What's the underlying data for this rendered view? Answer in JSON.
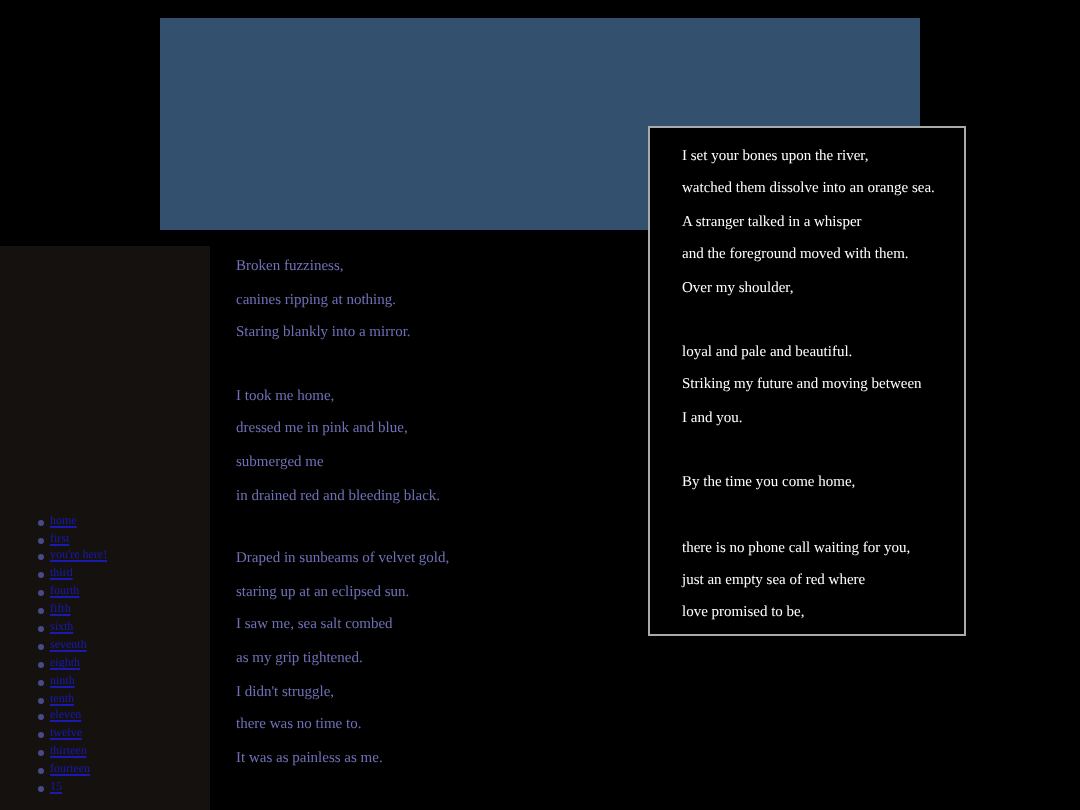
{
  "nav": {
    "links": [
      "home",
      "first",
      "you're here!",
      "third",
      "fourth",
      "fifth",
      "sixth",
      "seventh",
      "eighth",
      "ninth",
      "tenth",
      "eleven",
      "twelve",
      "thirteen",
      "fourteen",
      "15"
    ]
  },
  "poem": {
    "stanzas": [
      [
        "Broken fuzziness,",
        "canines ripping at nothing.",
        "Staring blankly into a mirror."
      ],
      [
        "I took me home,",
        "dressed me in pink and blue,",
        "submerged me",
        "in drained red and bleeding black."
      ],
      [
        "Draped in sunbeams of velvet gold,",
        "staring up at an eclipsed sun.",
        "I saw me, sea salt combed",
        "as my grip tightened.",
        "I didn't struggle,",
        "there was no time to.",
        "It was as painless as me."
      ]
    ]
  },
  "aside": {
    "stanzas": [
      [
        "I set your bones upon the river,",
        "watched them dissolve into an orange sea.",
        "A stranger talked in a whisper",
        "and the foreground moved with them.",
        "Over my shoulder,"
      ],
      [
        "loyal and pale and beautiful.",
        "Striking my future and moving between",
        "I and you."
      ],
      [
        "By the time you come home,"
      ],
      [
        "there is no phone call waiting for you,",
        "just an empty sea of red where",
        "love promised to be,"
      ]
    ]
  }
}
